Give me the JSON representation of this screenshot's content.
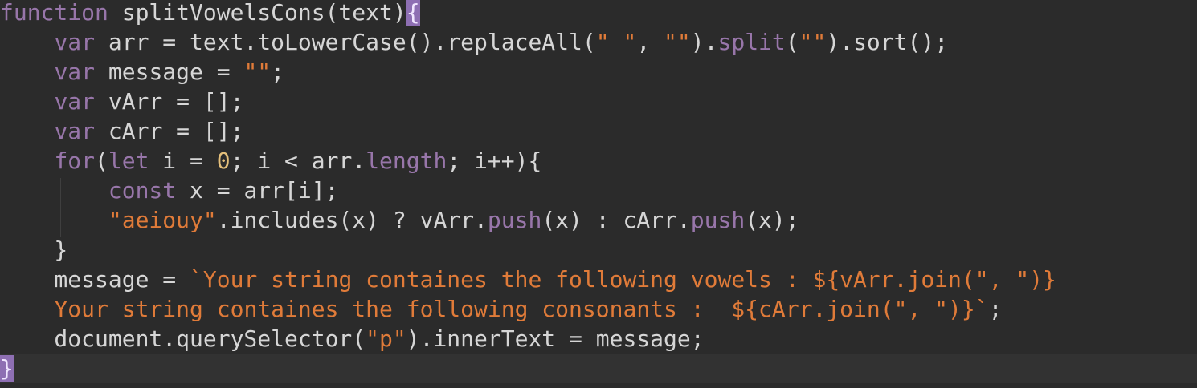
{
  "code": {
    "lines": [
      [
        {
          "text": "function",
          "type": "kw"
        },
        {
          "text": " splitVowelsCons(text)",
          "type": "plain"
        },
        {
          "text": "{",
          "type": "bracket-match"
        }
      ],
      [
        {
          "text": "    ",
          "type": "plain"
        },
        {
          "text": "var",
          "type": "kw"
        },
        {
          "text": " arr = text.toLowerCase().replaceAll(",
          "type": "plain"
        },
        {
          "text": "\" \"",
          "type": "str"
        },
        {
          "text": ", ",
          "type": "plain"
        },
        {
          "text": "\"\"",
          "type": "str"
        },
        {
          "text": ").",
          "type": "plain"
        },
        {
          "text": "split",
          "type": "prop"
        },
        {
          "text": "(",
          "type": "plain"
        },
        {
          "text": "\"\"",
          "type": "str"
        },
        {
          "text": ").sort();",
          "type": "plain"
        }
      ],
      [
        {
          "text": "    ",
          "type": "plain"
        },
        {
          "text": "var",
          "type": "kw"
        },
        {
          "text": " message = ",
          "type": "plain"
        },
        {
          "text": "\"\"",
          "type": "str"
        },
        {
          "text": ";",
          "type": "plain"
        }
      ],
      [
        {
          "text": "    ",
          "type": "plain"
        },
        {
          "text": "var",
          "type": "kw"
        },
        {
          "text": " vArr = [];",
          "type": "plain"
        }
      ],
      [
        {
          "text": "    ",
          "type": "plain"
        },
        {
          "text": "var",
          "type": "kw"
        },
        {
          "text": " cArr = [];",
          "type": "plain"
        }
      ],
      [
        {
          "text": "    ",
          "type": "plain"
        },
        {
          "text": "for",
          "type": "kw"
        },
        {
          "text": "(",
          "type": "plain"
        },
        {
          "text": "let",
          "type": "kw"
        },
        {
          "text": " i = ",
          "type": "plain"
        },
        {
          "text": "0",
          "type": "num"
        },
        {
          "text": "; i < arr.",
          "type": "plain"
        },
        {
          "text": "length",
          "type": "prop"
        },
        {
          "text": "; i++){",
          "type": "plain"
        }
      ],
      [
        {
          "text": "        ",
          "type": "plain"
        },
        {
          "text": "const",
          "type": "kw"
        },
        {
          "text": " x = arr[i];",
          "type": "plain"
        }
      ],
      [
        {
          "text": "        ",
          "type": "plain"
        },
        {
          "text": "\"aeiouy\"",
          "type": "str"
        },
        {
          "text": ".includes(x) ? vArr.",
          "type": "plain"
        },
        {
          "text": "push",
          "type": "prop"
        },
        {
          "text": "(x) : cArr.",
          "type": "plain"
        },
        {
          "text": "push",
          "type": "prop"
        },
        {
          "text": "(x);",
          "type": "plain"
        }
      ],
      [
        {
          "text": "    }",
          "type": "plain"
        }
      ],
      [
        {
          "text": "    message = ",
          "type": "plain"
        },
        {
          "text": "`Your string containes the following vowels : ",
          "type": "str"
        },
        {
          "text": "${vArr.join(",
          "type": "str"
        },
        {
          "text": "\", \"",
          "type": "str"
        },
        {
          "text": ")}",
          "type": "str"
        }
      ],
      [
        {
          "text": "    ",
          "type": "plain"
        },
        {
          "text": "Your string containes the following consonants :  ",
          "type": "str"
        },
        {
          "text": "${cArr.join(",
          "type": "str"
        },
        {
          "text": "\", \"",
          "type": "str"
        },
        {
          "text": ")}`",
          "type": "str"
        },
        {
          "text": ";",
          "type": "plain"
        }
      ],
      [
        {
          "text": "    document.querySelector(",
          "type": "plain"
        },
        {
          "text": "\"p\"",
          "type": "str"
        },
        {
          "text": ").innerText = message;",
          "type": "plain"
        }
      ],
      [
        {
          "text": "}",
          "type": "bracket-match"
        }
      ]
    ],
    "current_line": 12
  },
  "colors": {
    "background": "#2b2b2b",
    "keyword": "#9876aa",
    "string": "#e07b39",
    "number": "#e5c07b",
    "plain": "#d6d6d6",
    "bracket_match": "#8e6fb3"
  }
}
